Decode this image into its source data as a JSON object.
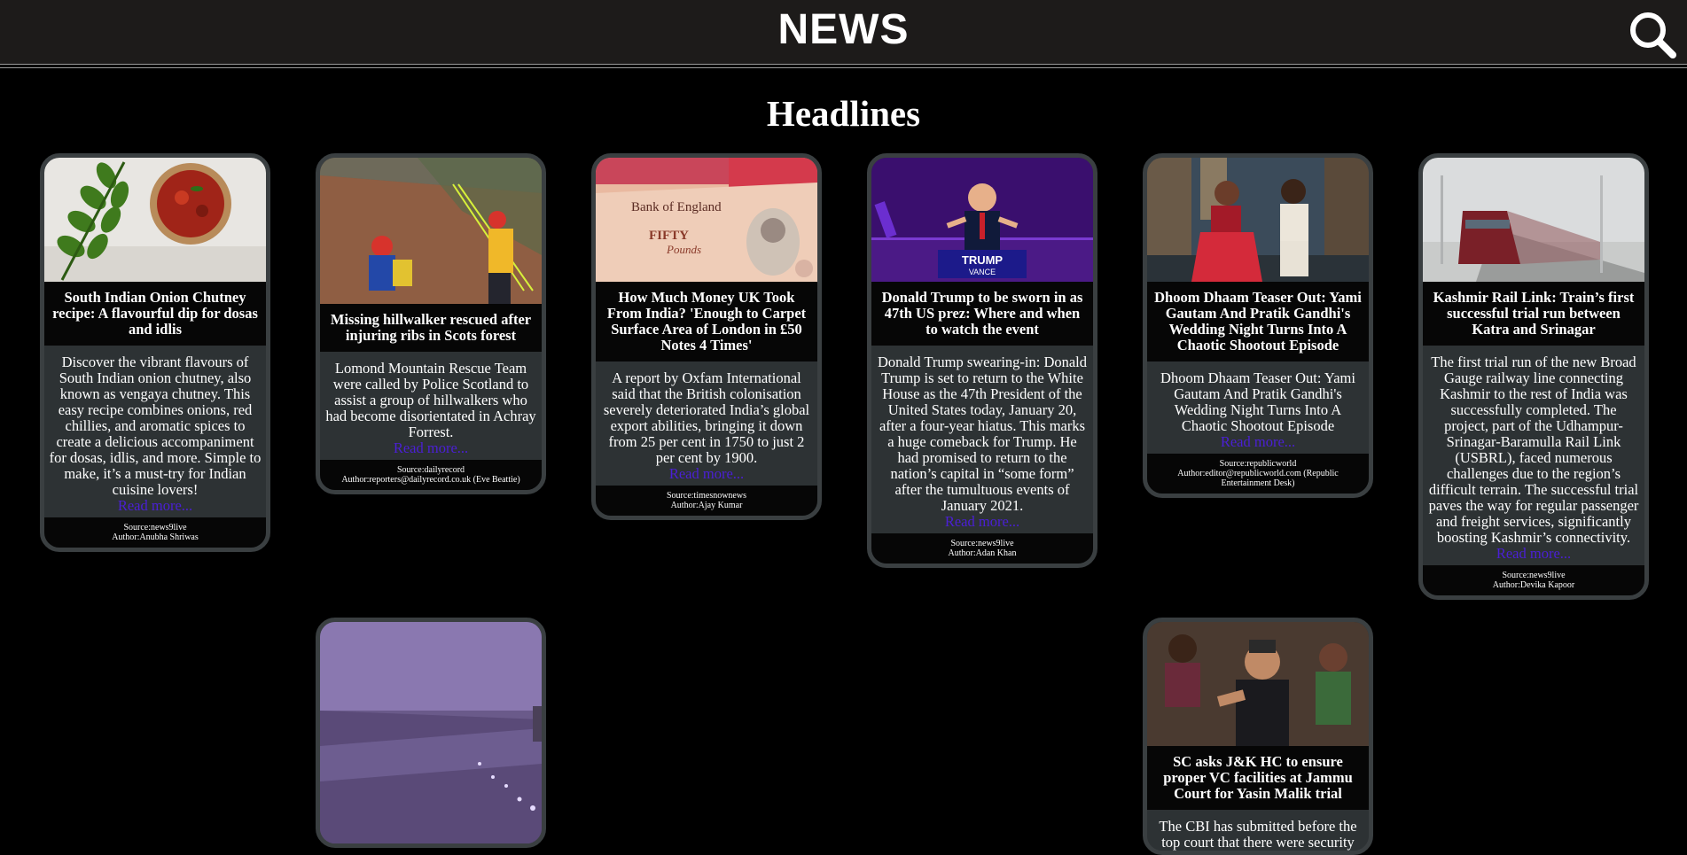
{
  "header": {
    "brand": "NEWS",
    "search_icon": "search-icon"
  },
  "page_title": "Headlines",
  "colors": {
    "background": "#000000",
    "topbar": "#1d1b1a",
    "card": "#2d3234",
    "link": "#4b1fd6"
  },
  "articles": [
    {
      "title": "South Indian Onion Chutney recipe: A flavourful dip for dosas and idlis",
      "description": "Discover the vibrant flavours of South Indian onion chutney, also known as vengaya chutney. This easy recipe combines onions, red chillies, and aromatic spices to create a delicious accompaniment for dosas, idlis, and more. Simple to make, it’s a must-try for Indian cuisine lovers!",
      "read_more": "Read more...",
      "source": "Source:news9live",
      "author": "Author:Anubha Shriwas"
    },
    {
      "title": "Missing hillwalker rescued after injuring ribs in Scots forest",
      "description": "Lomond Mountain Rescue Team were called by Police Scotland to assist a group of hillwalkers who had become disorientated in Achray Forrest.",
      "read_more": "Read more...",
      "source": "Source:dailyrecord",
      "author": "Author:reporters@dailyrecord.co.uk (Eve Beattie)"
    },
    {
      "title": "How Much Money UK Took From India? 'Enough to Carpet Surface Area of London in £50 Notes 4 Times'",
      "description": "A report by Oxfam International said that the British colonisation severely deteriorated India’s global export abilities, bringing it down from 25 per cent in 1750 to just 2 per cent by 1900.",
      "read_more": "Read more...",
      "source": "Source:timesnownews",
      "author": "Author:Ajay Kumar",
      "image_text": [
        "Bank of England",
        "FIFTY",
        "Pounds"
      ]
    },
    {
      "title": "Donald Trump to be sworn in as 47th US prez: Where and when to watch the event",
      "description": "Donald Trump swearing-in: Donald Trump is set to return to the White House as the 47th President of the United States today, January 20, after a four-year hiatus. This marks a huge comeback for Trump. He had promised to return to the nation’s capital in “some form” after the tumultuous events of January 2021.",
      "read_more": "Read more...",
      "source": "Source:news9live",
      "author": "Author:Adan Khan",
      "image_text": [
        "TRUMP",
        "VANCE"
      ]
    },
    {
      "title": "Dhoom Dhaam Teaser Out: Yami Gautam And Pratik Gandhi's Wedding Night Turns Into A Chaotic Shootout Episode",
      "description": "Dhoom Dhaam Teaser Out: Yami Gautam And Pratik Gandhi's Wedding Night Turns Into A Chaotic Shootout Episode",
      "read_more": "Read more...",
      "source": "Source:republicworld",
      "author": "Author:editor@republicworld.com (Republic Entertainment Desk)"
    },
    {
      "title": "Kashmir Rail Link: Train’s first successful trial run between Katra and Srinagar",
      "description": "The first trial run of the new Broad Gauge railway line connecting Kashmir to the rest of India was successfully completed. The project, part of the Udhampur-Srinagar-Baramulla Rail Link (USBRL), faced numerous challenges due to the region’s difficult terrain. The successful trial paves the way for regular passenger and freight services, significantly boosting Kashmir’s connectivity.",
      "read_more": "Read more...",
      "source": "Source:news9live",
      "author": "Author:Devika Kapoor"
    },
    {
      "title": "",
      "description": "",
      "read_more": "",
      "source": "",
      "author": ""
    },
    {
      "title": "SC asks J&K HC to ensure proper VC facilities at Jammu Court for Yasin Malik trial",
      "description": "The CBI has submitted before the top court that there were security",
      "read_more": "",
      "source": "",
      "author": ""
    }
  ]
}
